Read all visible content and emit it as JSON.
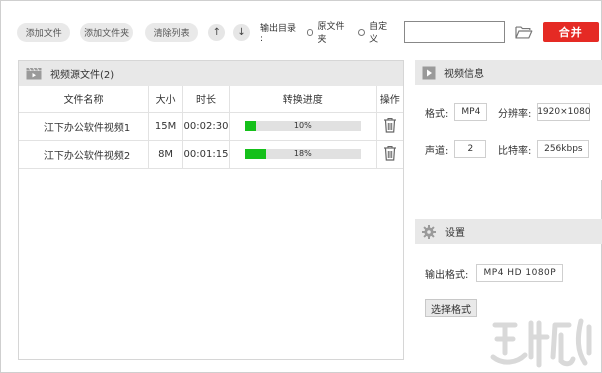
{
  "toolbar": {
    "add_file": "添加文件",
    "add_folder": "添加文件夹",
    "clear_list": "清除列表",
    "up_glyph": "↑",
    "down_glyph": "↓",
    "output_dir_label": "输出目录 :",
    "option_source": "原文件夹",
    "option_custom": "自定义",
    "path_value": "",
    "merge": "合并"
  },
  "source_panel": {
    "title": "视频源文件(2)",
    "columns": [
      "文件名称",
      "大小",
      "时长",
      "转换进度",
      "操作"
    ],
    "rows": [
      {
        "name": "江下办公软件视频1",
        "size": "15M",
        "duration": "00:02:30",
        "progress_text": "10%",
        "progress": 10
      },
      {
        "name": "江下办公软件视频2",
        "size": "8M",
        "duration": "00:01:15",
        "progress_text": "18%",
        "progress": 18
      }
    ]
  },
  "video_info": {
    "title": "视频信息",
    "format_label": "格式:",
    "format_value": "MP4",
    "resolution_label": "分辨率:",
    "resolution_value": "1920×1080",
    "channel_label": "声道:",
    "channel_value": "2",
    "bitrate_label": "比特率:",
    "bitrate_value": "256kbps"
  },
  "settings": {
    "title": "设置",
    "output_format_label": "输出格式:",
    "output_format_value": "MP4  HD  1080P",
    "choose_format": "选择格式"
  },
  "colors": {
    "accent": "#e52a24",
    "progress": "#15c01a"
  }
}
